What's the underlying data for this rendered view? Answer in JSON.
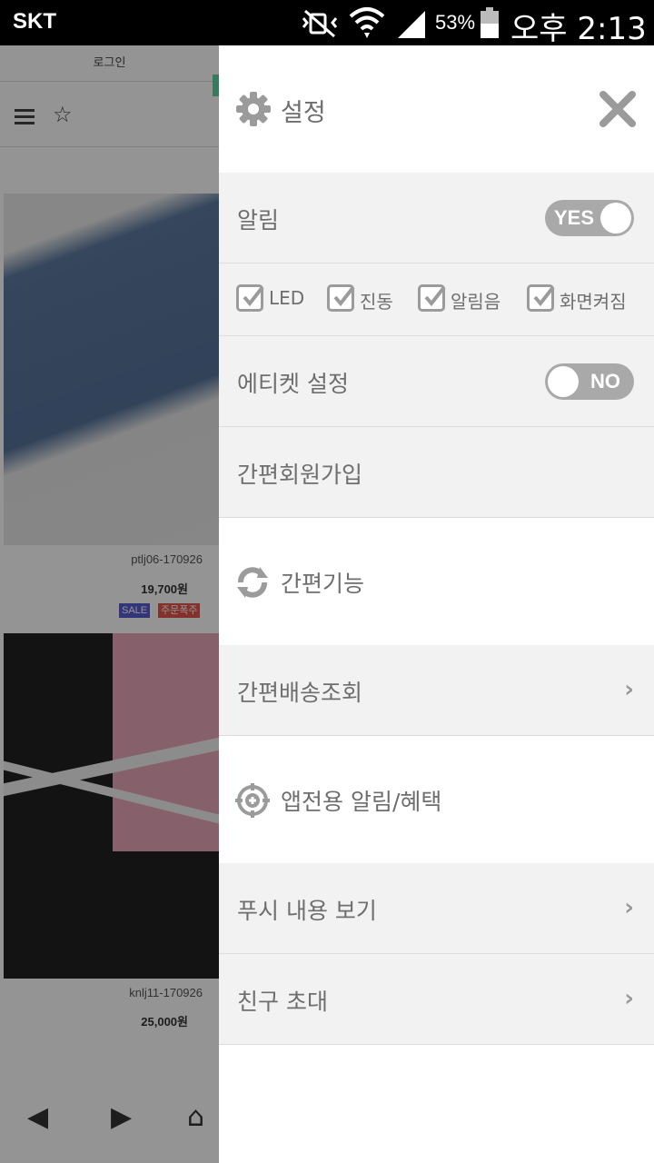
{
  "status_bar": {
    "carrier": "SKT",
    "battery_percent": "53%",
    "time": "오후 2:13"
  },
  "background_page": {
    "login_label": "로그인",
    "products": [
      {
        "code": "ptlj06-170926",
        "price": "19,700원",
        "badges": [
          "SALE",
          "주문폭주"
        ]
      },
      {
        "code": "knlj11-170926",
        "price": "25,000원",
        "badges": []
      }
    ]
  },
  "drawer": {
    "header": {
      "title": "설정",
      "icon": "gear-icon",
      "close_icon": "close-icon"
    },
    "notification": {
      "label": "알림",
      "toggle_text": "YES",
      "toggle_on": true
    },
    "options": [
      {
        "label": "LED",
        "checked": true
      },
      {
        "label": "진동",
        "checked": true
      },
      {
        "label": "알림음",
        "checked": true
      },
      {
        "label": "화면켜짐",
        "checked": true
      }
    ],
    "etiquette": {
      "label": "에티켓 설정",
      "toggle_text": "NO",
      "toggle_on": false
    },
    "easy_signup": {
      "label": "간편회원가입"
    },
    "easy_features_header": {
      "label": "간편기능",
      "icon": "refresh-icon"
    },
    "delivery_lookup": {
      "label": "간편배송조회"
    },
    "app_benefits_header": {
      "label": "앱전용 알림/혜택",
      "icon": "target-plus-icon"
    },
    "push_view": {
      "label": "푸시 내용 보기"
    },
    "invite_friends": {
      "label": "친구 초대"
    }
  },
  "colors": {
    "drawer_gray_row": "#f2f2f2",
    "text_gray": "#6e6e6e",
    "toggle_gray": "#a9a9a9"
  }
}
